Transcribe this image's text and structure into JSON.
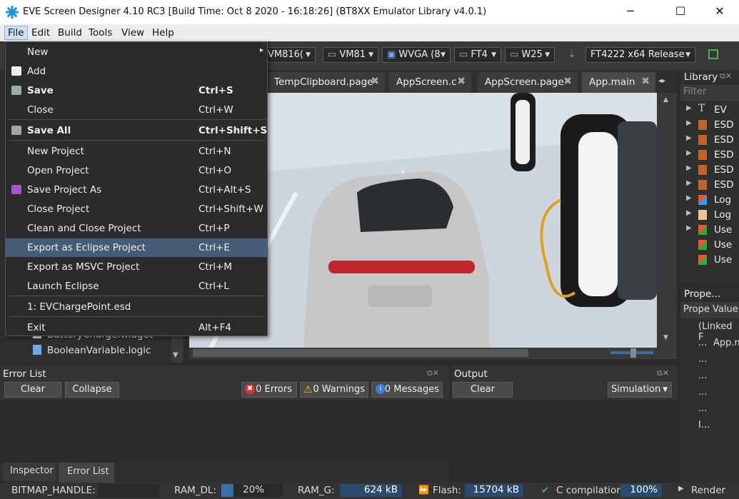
{
  "titlebar": {
    "title": "EVE Screen Designer 4.10 RC3  [Build Time: Oct  8 2020 - 16:18:26]  (BT8XX Emulator Library v4.0.1)",
    "minimize": "─",
    "maximize": "☐",
    "close": "✕"
  },
  "menubar": {
    "items": [
      "File",
      "Edit",
      "Build",
      "Tools",
      "View",
      "Help"
    ]
  },
  "toolbar": {
    "combos": [
      "VM816(",
      "VM81",
      "WVGA (8",
      "FT4",
      "W25",
      "FT4222 x64 Release"
    ]
  },
  "file_menu": {
    "items": [
      {
        "label": "New",
        "shortcut": "",
        "submenu": "▸"
      },
      {
        "label": "Add",
        "shortcut": ""
      },
      {
        "label": "Save",
        "shortcut": "Ctrl+S"
      },
      {
        "label": "Close",
        "shortcut": "Ctrl+W"
      },
      {
        "label": "Save All",
        "shortcut": "Ctrl+Shift+S"
      },
      {
        "label": "New Project",
        "shortcut": "Ctrl+N"
      },
      {
        "label": "Open Project",
        "shortcut": "Ctrl+O"
      },
      {
        "label": "Save Project As",
        "shortcut": "Ctrl+Alt+S"
      },
      {
        "label": "Close Project",
        "shortcut": "Ctrl+Shift+W"
      },
      {
        "label": "Clean and Close Project",
        "shortcut": "Ctrl+P"
      },
      {
        "label": "Export as Eclipse Project",
        "shortcut": "Ctrl+E"
      },
      {
        "label": "Export as MSVC Project",
        "shortcut": "Ctrl+M"
      },
      {
        "label": "Launch Eclipse",
        "shortcut": "Ctrl+L"
      },
      {
        "label": "1: EVChargePoint.esd",
        "shortcut": ""
      },
      {
        "label": "Exit",
        "shortcut": "Alt+F4"
      }
    ]
  },
  "tabs": [
    {
      "label": "TempClipboard.page"
    },
    {
      "label": "AppScreen.c"
    },
    {
      "label": "AppScreen.page"
    },
    {
      "label": "App.main"
    }
  ],
  "project_tree": {
    "items": [
      "BatteryCharge.widget",
      "BooleanVariable.logic"
    ]
  },
  "library": {
    "title": "Library",
    "filter_placeholder": "Filter",
    "items": [
      "EV",
      "ESD",
      "ESD",
      "ESD",
      "ESD",
      "ESD",
      "Log",
      "Log",
      "Use",
      "Use",
      "Use"
    ]
  },
  "properties": {
    "title": "Prope...",
    "col_name": "Prope",
    "col_value": "Value",
    "rows": [
      [
        "(Linked F",
        ""
      ],
      [
        "...",
        "App.m"
      ],
      [
        "...",
        ""
      ],
      [
        "...",
        ""
      ],
      [
        "...",
        ""
      ],
      [
        "...",
        ""
      ],
      [
        "I...",
        ""
      ]
    ]
  },
  "error_list": {
    "title": "Error List",
    "clear": "Clear",
    "collapse": "Collapse",
    "errors": "0 Errors",
    "warnings": "0 Warnings",
    "messages": "0 Messages"
  },
  "output": {
    "title": "Output",
    "clear": "Clear",
    "mode": "Simulation"
  },
  "bottom_tabs": [
    "Inspector",
    "Error List"
  ],
  "statusbar": {
    "bitmap_label": "BITMAP_HANDLE:",
    "ram_dl_label": "RAM_DL:",
    "ram_dl_value": "20%",
    "ram_g_label": "RAM_G:",
    "ram_g_value": "624 kB",
    "flash_label": "Flash:",
    "flash_value": "15704 kB",
    "compile_label": "C compilation",
    "compile_value": "100%",
    "render_label": "Render"
  },
  "colors": {
    "accent": "#465b76",
    "brand_icon": "#1e90d8"
  }
}
